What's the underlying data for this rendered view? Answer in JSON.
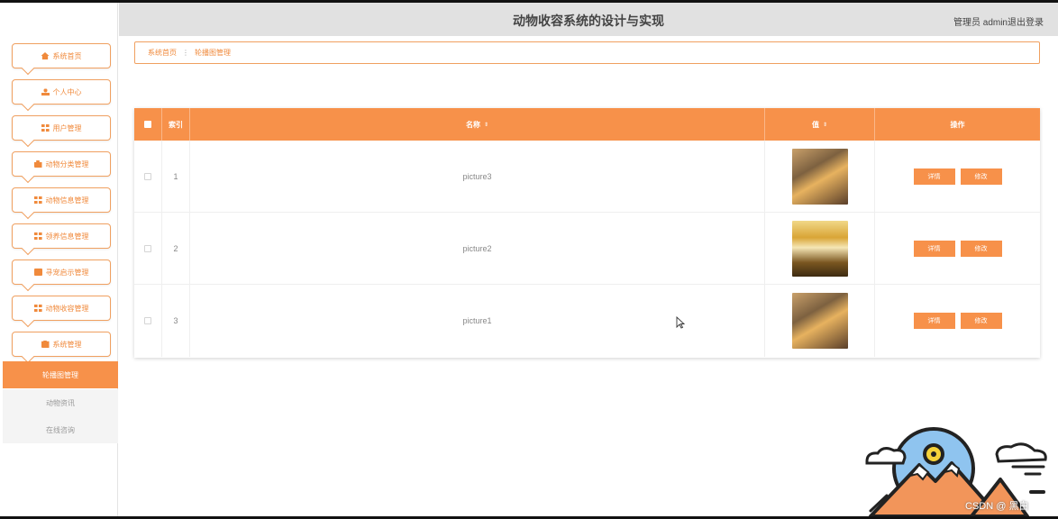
{
  "header": {
    "title": "动物收容系统的设计与实现",
    "user": "管理员 admin",
    "logout": "退出登录"
  },
  "sidebar": {
    "menu": [
      {
        "label": "系统首页",
        "icon": "home-icon"
      },
      {
        "label": "个人中心",
        "icon": "user-icon"
      },
      {
        "label": "用户管理",
        "icon": "grid-icon"
      },
      {
        "label": "动物分类管理",
        "icon": "briefcase-icon"
      },
      {
        "label": "动物信息管理",
        "icon": "grid-icon"
      },
      {
        "label": "领养信息管理",
        "icon": "grid-icon"
      },
      {
        "label": "寻宠启示管理",
        "icon": "calendar-icon"
      },
      {
        "label": "动物收容管理",
        "icon": "grid-icon"
      },
      {
        "label": "系统管理",
        "icon": "clipboard-icon"
      }
    ],
    "submenu": [
      {
        "label": "轮播图管理",
        "active": true
      },
      {
        "label": "动物资讯",
        "active": false
      },
      {
        "label": "在线咨询",
        "active": false
      }
    ]
  },
  "breadcrumb": {
    "home": "系统首页",
    "separator": "⋮",
    "current": "轮播图管理"
  },
  "table": {
    "columns": {
      "index": "索引",
      "name": "名称",
      "value": "值",
      "actions": "操作"
    },
    "sort_icon": "⇕",
    "rows": [
      {
        "index": "1",
        "name": "picture3",
        "image": "misty-landscape-thumbnail"
      },
      {
        "index": "2",
        "name": "picture2",
        "image": "golden-city-thumbnail"
      },
      {
        "index": "3",
        "name": "picture1",
        "image": "misty-landscape-thumbnail"
      }
    ],
    "detail_label": "详情",
    "edit_label": "修改"
  },
  "watermark": "CSDN @ 黑白",
  "colors": {
    "accent": "#f7914a",
    "header_bg": "#e1e1e1",
    "submenu_bg": "#f4f4f4"
  }
}
